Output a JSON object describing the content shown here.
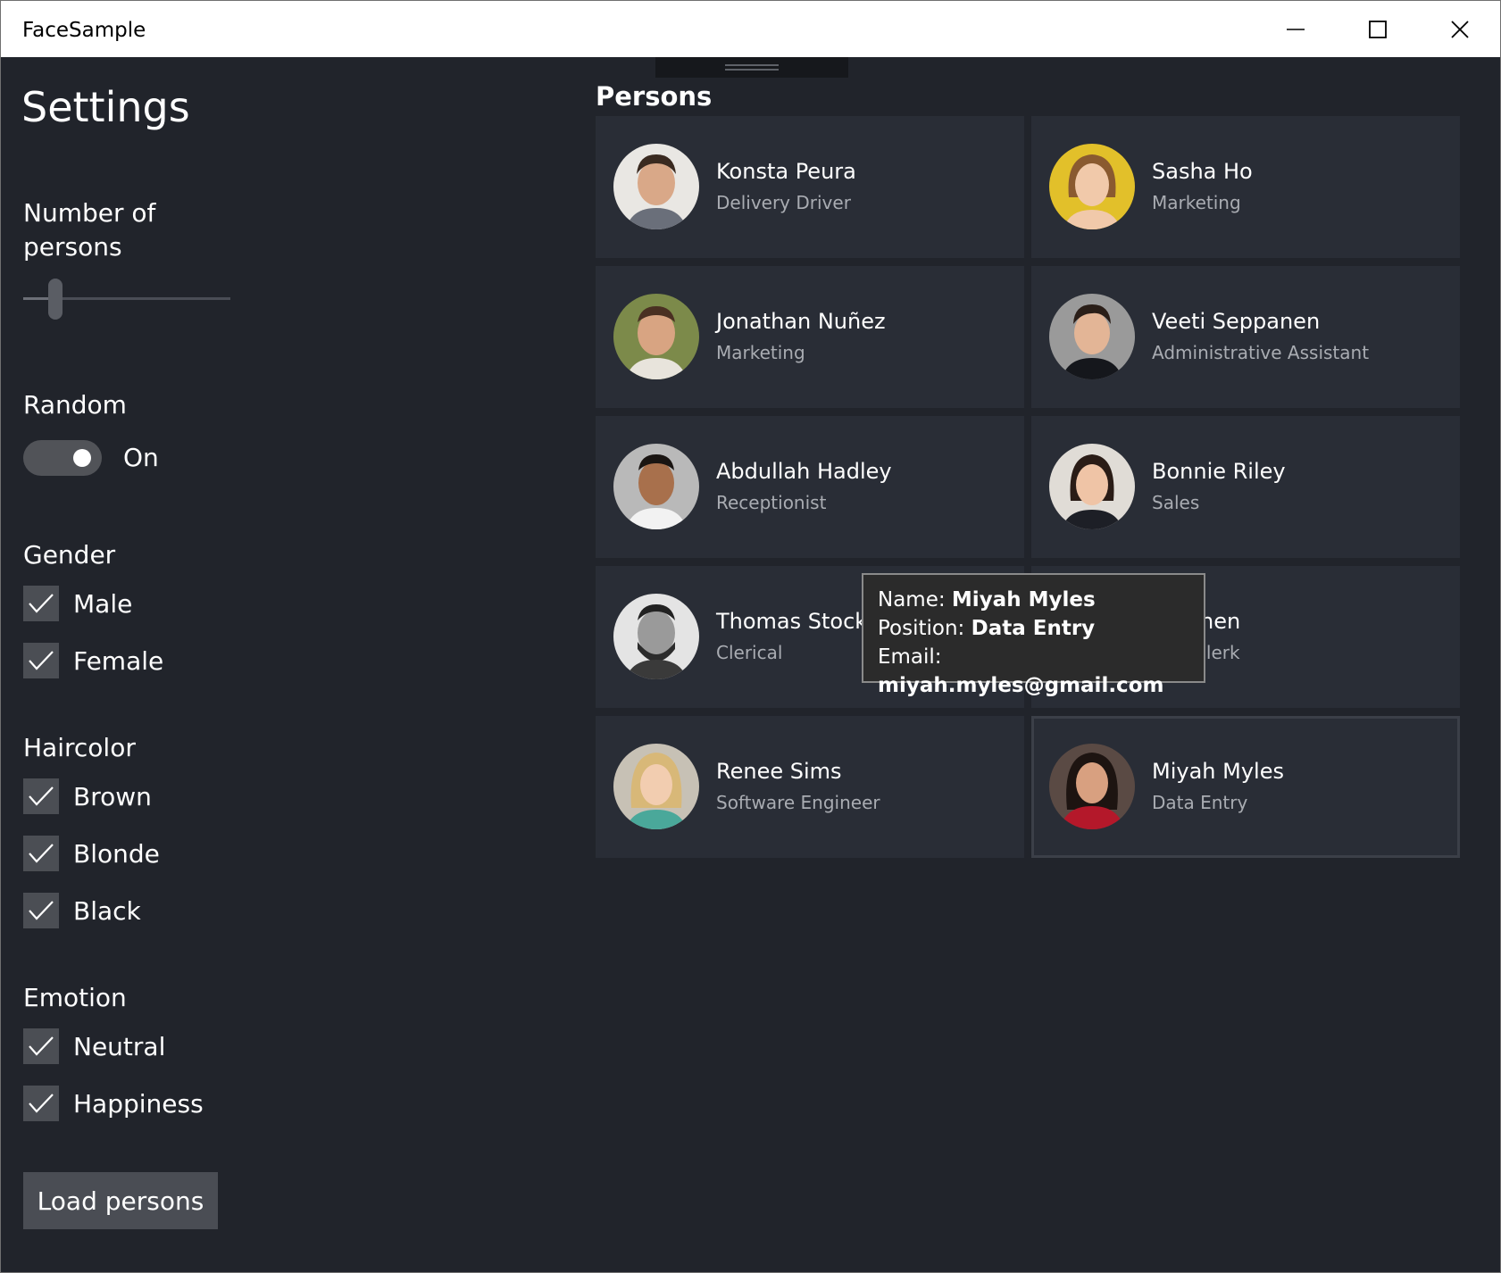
{
  "window": {
    "title": "FaceSample"
  },
  "settings": {
    "title": "Settings",
    "number_label": "Number of persons",
    "number_value_fraction": 0.13,
    "random_label": "Random",
    "random_state": "On",
    "gender_label": "Gender",
    "gender_options": [
      "Male",
      "Female"
    ],
    "haircolor_label": "Haircolor",
    "haircolor_options": [
      "Brown",
      "Blonde",
      "Black"
    ],
    "emotion_label": "Emotion",
    "emotion_options": [
      "Neutral",
      "Happiness"
    ],
    "load_button": "Load persons"
  },
  "persons": {
    "title": "Persons",
    "items": [
      {
        "name": "Konsta Peura",
        "role": "Delivery Driver"
      },
      {
        "name": "Sasha Ho",
        "role": "Marketing"
      },
      {
        "name": "Jonathan Nuñez",
        "role": "Marketing"
      },
      {
        "name": "Veeti Seppanen",
        "role": "Administrative Assistant"
      },
      {
        "name": "Abdullah Hadley",
        "role": "Receptionist"
      },
      {
        "name": "Bonnie Riley",
        "role": "Sales"
      },
      {
        "name": "Thomas Stock",
        "role": "Clerical"
      },
      {
        "name": "liskanen",
        "role": "ntry Clerk"
      },
      {
        "name": "Renee Sims",
        "role": "Software Engineer"
      },
      {
        "name": "Miyah Myles",
        "role": "Data Entry"
      }
    ]
  },
  "tooltip": {
    "name_label": "Name:",
    "name_value": "Miyah Myles",
    "position_label": "Position:",
    "position_value": "Data Entry",
    "email_label": "Email:",
    "email_value": "miyah.myles@gmail.com"
  }
}
